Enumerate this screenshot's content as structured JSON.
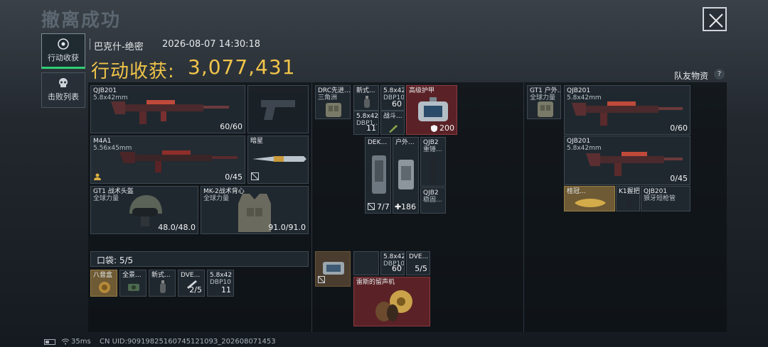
{
  "title": "撤离成功",
  "tabs": [
    {
      "label": "行动收获",
      "icon": "target-icon",
      "active": true
    },
    {
      "label": "击败列表",
      "icon": "skull-icon",
      "active": false
    }
  ],
  "header": {
    "map": "巴克什-绝密",
    "time": "2026-08-07 14:30:18"
  },
  "gain": {
    "label": "行动收获:",
    "value": "3,077,431"
  },
  "team_label": "队友物资",
  "help_glyph": "?",
  "colors": {
    "gold": "#f0c44a",
    "accent_green": "#2ecf73",
    "red_slot": "#5a2226"
  },
  "loadout": {
    "primary": {
      "name": "QJB201",
      "caliber": "5.8x42mm",
      "ammo": "60/60"
    },
    "pistol": {
      "icon": "pistol-icon"
    },
    "secondary": {
      "name": "M4A1",
      "caliber": "5.56x45mm",
      "ammo": "0/45"
    },
    "melee": {
      "name": "暗星"
    },
    "helmet": {
      "name": "GT1 战术头盔",
      "brand": "全球力量",
      "durability": "48.0/48.0"
    },
    "armor": {
      "name": "MK-2战术背心",
      "brand": "全球力量",
      "durability": "91.0/91.0"
    }
  },
  "pocket": {
    "label": "口袋:",
    "count": "5/5"
  },
  "pocket_items": [
    {
      "name": "八音盒",
      "count": ""
    },
    {
      "name": "全景...",
      "count": ""
    },
    {
      "name": "新式...",
      "count": ""
    },
    {
      "name": "DVE...",
      "count": "2/5"
    },
    {
      "name": "5.8x42",
      "sub": "DBP10",
      "count": "11"
    }
  ],
  "backpack_items": [
    {
      "name": "DRC先进...",
      "sub": "三角洲"
    },
    {
      "name": "新式...",
      "count": ""
    },
    {
      "name": "5.8x42",
      "sub": "DBP10",
      "count": "60"
    },
    {
      "name": "高级护甲",
      "count": "200"
    },
    {
      "name": "5.8x42",
      "sub": "DBP1...",
      "count": "11"
    },
    {
      "name": "战斗...",
      "count": ""
    },
    {
      "name": "DEK...",
      "count": "7/7"
    },
    {
      "name": "户外...",
      "count": "186"
    },
    {
      "name": "QJB2",
      "sub": "重锤..."
    },
    {
      "name": "QJB2",
      "sub": "稳固..."
    }
  ],
  "chest_items": [
    {
      "name": "5.8x42",
      "sub": "DBP10",
      "count": "60"
    },
    {
      "name": "DVE...",
      "count": "5/5"
    },
    {
      "name": "雷斯的留声机",
      "count": ""
    }
  ],
  "teammate": {
    "vest": {
      "name": "GT1 户外...",
      "brand": "全球力量"
    },
    "gun1": {
      "name": "QJB201",
      "caliber": "5.8x42mm",
      "ammo": "0/60"
    },
    "gun2": {
      "name": "QJB201",
      "caliber": "5.8x42mm",
      "ammo": "0/45"
    },
    "attachments": [
      {
        "name": "桂冠..."
      },
      {
        "name": "K1握把"
      },
      {
        "name": "QJB201",
        "sub": "狼牙短枪管"
      }
    ]
  },
  "status": {
    "ping": "35ms",
    "uid": "CN UID:9091982516074512109З_202608071453"
  }
}
